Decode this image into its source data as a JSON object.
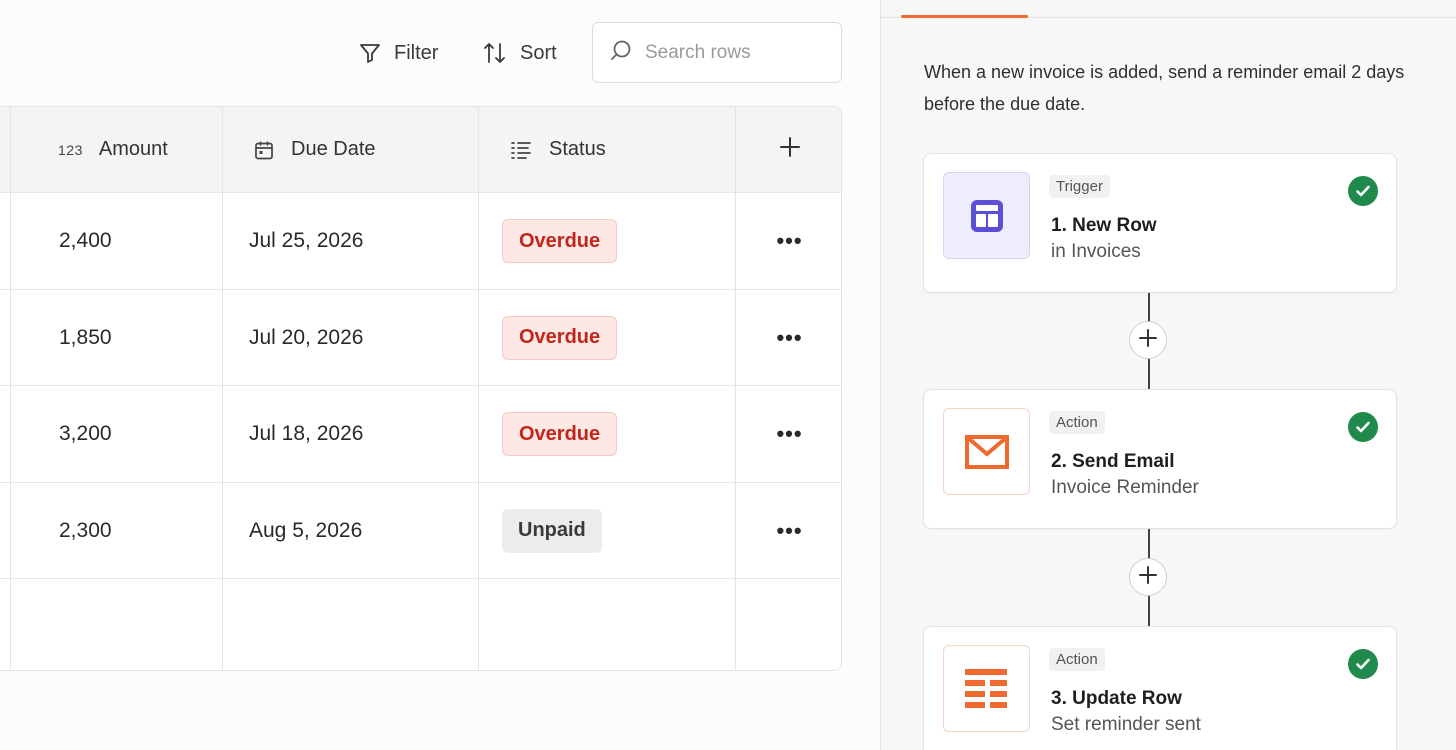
{
  "toolbar": {
    "filter_label": "Filter",
    "sort_label": "Sort",
    "search_placeholder": "Search rows"
  },
  "table": {
    "columns": [
      {
        "label": "Amount",
        "type_label": "123",
        "icon": "number-icon"
      },
      {
        "label": "Due Date",
        "icon": "calendar-icon"
      },
      {
        "label": "Status",
        "icon": "list-icon"
      }
    ],
    "add_column_icon": "plus-icon",
    "rows": [
      {
        "amount": "2,400",
        "due_date": "Jul 25, 2026",
        "status": "Overdue",
        "status_kind": "overdue"
      },
      {
        "amount": "1,850",
        "due_date": "Jul 20, 2026",
        "status": "Overdue",
        "status_kind": "overdue"
      },
      {
        "amount": "3,200",
        "due_date": "Jul 18, 2026",
        "status": "Overdue",
        "status_kind": "overdue"
      },
      {
        "amount": "2,300",
        "due_date": "Aug 5, 2026",
        "status": "Unpaid",
        "status_kind": "unpaid"
      }
    ],
    "row_menu_label": "•••"
  },
  "panel": {
    "description": "When a new invoice is added, send a reminder email 2 days before the due date.",
    "steps": [
      {
        "type": "Trigger",
        "title": "1. New Row",
        "subtitle": "in Invoices",
        "icon": "table-icon",
        "status": "complete"
      },
      {
        "type": "Action",
        "title": "2. Send Email",
        "subtitle": "Invoice Reminder",
        "icon": "mail-icon",
        "status": "complete"
      },
      {
        "type": "Action",
        "title": "3. Update Row",
        "subtitle": "Set reminder sent",
        "icon": "update-row-icon",
        "status": "complete"
      }
    ],
    "colors": {
      "accent": "#ef6a2e",
      "success": "#1f8a4c",
      "overdue_text": "#c2261b",
      "overdue_bg": "#fde8e6",
      "trigger_icon": "#5b4fd6"
    }
  }
}
